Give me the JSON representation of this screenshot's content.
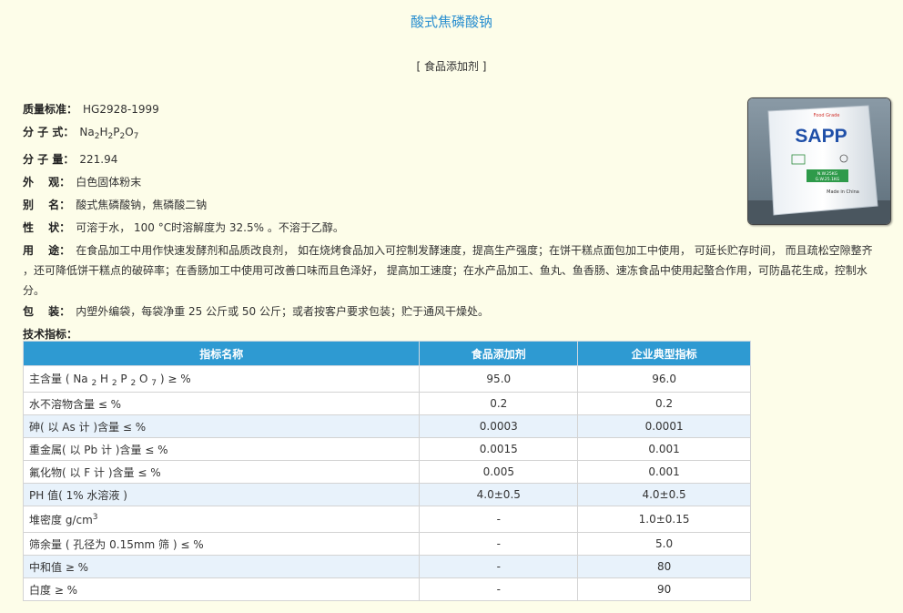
{
  "title": "酸式焦磷酸钠",
  "category": "[ 食品添加剂 ]",
  "info": {
    "standard_label": "质量标准：",
    "standard_value": "HG2928-1999",
    "formula_label": "分 子 式：",
    "formula_parts": [
      "Na",
      "2",
      "H",
      "2",
      "P",
      "2",
      "O",
      "7"
    ],
    "weight_label": "分 子 量：",
    "weight_value": "221.94",
    "appearance_label": "外　 观：",
    "appearance_value": "白色固体粉末",
    "alias_label": "别　 名：",
    "alias_value": "酸式焦磷酸钠，焦磷酸二钠",
    "property_label": "性　 状：",
    "property_value": "可溶于水， 100 °C时溶解度为 32.5% 。不溶于乙醇。",
    "usage_label": "用　 途：",
    "usage_value": "在食品加工中用作快速发酵剂和品质改良剂， 如在烧烤食品加入可控制发酵速度，提高生产强度；在饼干糕点面包加工中使用， 可延长贮存时间， 而且疏松空隙整齐 ，还可降低饼干糕点的破碎率；在香肠加工中使用可改善口味而且色泽好， 提高加工速度；在水产品加工、鱼丸、鱼香肠、速冻食品中使用起螯合作用，可防晶花生成，控制水分。",
    "package_label": "包　 装：",
    "package_value": "内塑外编袋，每袋净重 25 公斤或 50 公斤；或者按客户要求包装；贮于通风干燥处。",
    "tech_label": "技术指标："
  },
  "photo": {
    "brand": "SAPP",
    "top_text": "Food Grade",
    "nw": "N.W.25KG",
    "gw": "G.W.25.1KG",
    "origin": "Made in China"
  },
  "table": {
    "headers": [
      "指标名称",
      "食品添加剂",
      "企业典型指标"
    ],
    "row0": {
      "pre": "主含量 ( ",
      "parts": [
        "Na ",
        "2",
        " H ",
        "2",
        " P ",
        "2",
        " O ",
        "7"
      ],
      "post": " ) ≥ %",
      "v1": "95.0",
      "v2": "96.0"
    },
    "rows": [
      [
        "水不溶物含量 ≤ %",
        "0.2",
        "0.2"
      ],
      [
        "砷( 以 As 计 )含量 ≤ %",
        "0.0003",
        "0.0001"
      ],
      [
        "重金属( 以 Pb 计 )含量 ≤ %",
        "0.0015",
        "0.001"
      ],
      [
        "氟化物( 以 F 计 )含量 ≤ %",
        "0.005",
        "0.001"
      ],
      [
        "PH 值( 1% 水溶液 )",
        "4.0±0.5",
        "4.0±0.5"
      ]
    ],
    "density": {
      "label": "堆密度 g/cm",
      "sup": "3",
      "v1": "-",
      "v2": "1.0±0.15"
    },
    "rows_after": [
      [
        "筛余量 ( 孔径为 0.15mm 筛 ) ≤ %",
        "-",
        "5.0"
      ],
      [
        "中和值 ≥ %",
        "-",
        "80"
      ],
      [
        "白度 ≥ %",
        "-",
        "90"
      ]
    ]
  },
  "colors": {
    "page_bg": "#fdfde9",
    "title": "#2a8fd0",
    "table_header": "#2e9ad2",
    "row_alt": "#e8f2fb"
  }
}
